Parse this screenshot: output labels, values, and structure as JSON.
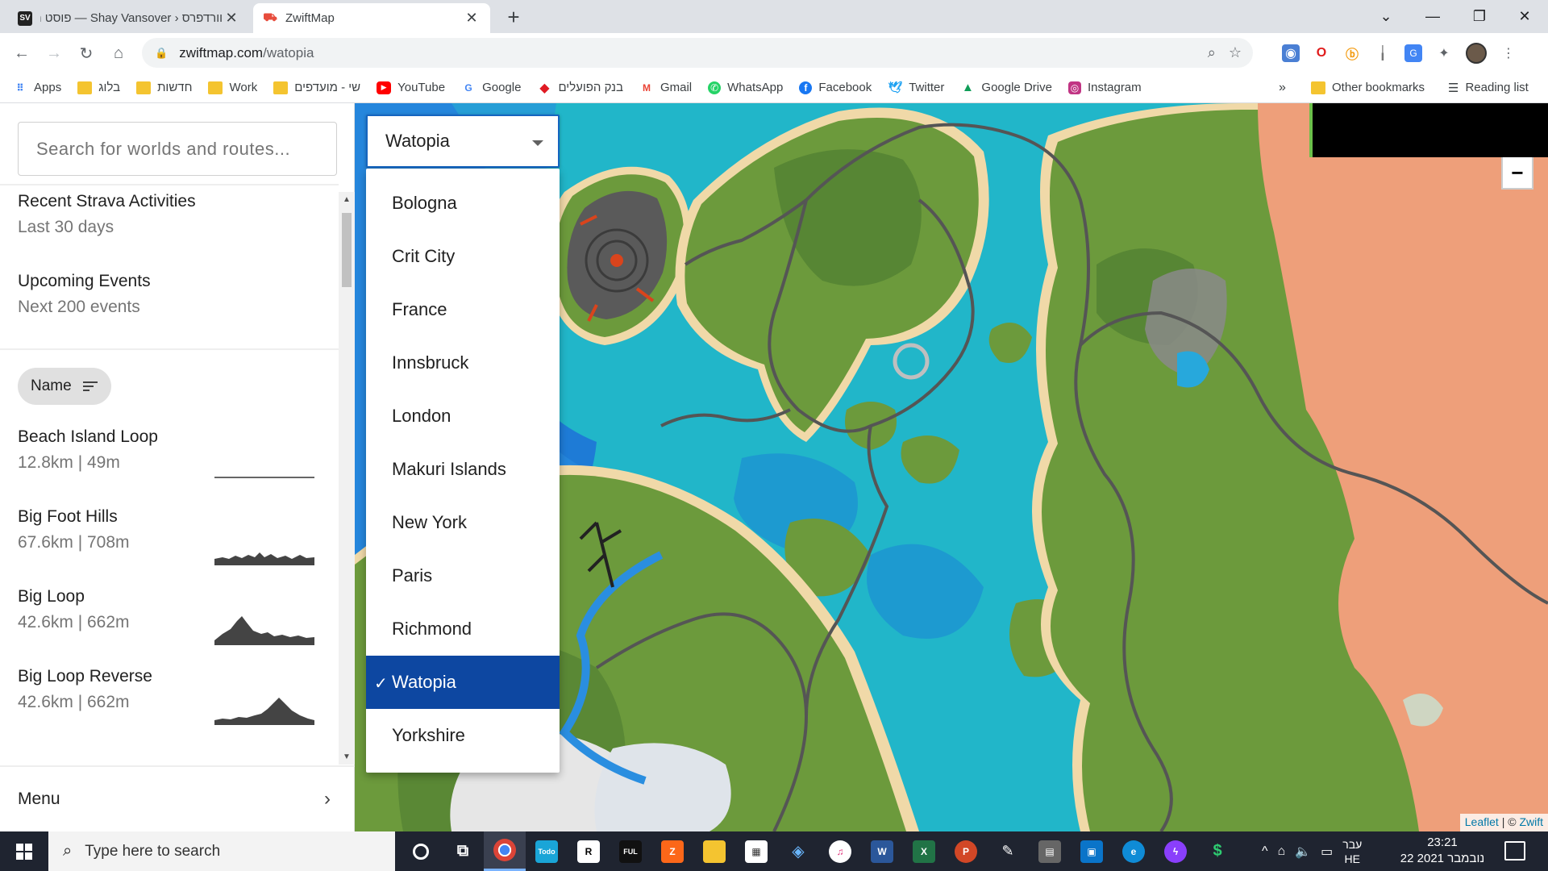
{
  "browser": {
    "tabs": [
      {
        "title": "וורדפרס ‹ Shay Vansover — פוסט חדש",
        "favicon": "SV"
      },
      {
        "title": "ZwiftMap",
        "favicon": "zwift-icon"
      }
    ],
    "url_host": "zwiftmap.com",
    "url_path": "/watopia",
    "bookmarks": [
      {
        "label": "Apps",
        "icon": "apps-grid-icon"
      },
      {
        "label": "בלוג",
        "icon": "folder-icon"
      },
      {
        "label": "חדשות",
        "icon": "folder-icon"
      },
      {
        "label": "Work",
        "icon": "folder-icon"
      },
      {
        "label": "שי - מועדפים",
        "icon": "folder-icon"
      },
      {
        "label": "YouTube",
        "icon": "youtube-icon"
      },
      {
        "label": "Google",
        "icon": "google-icon"
      },
      {
        "label": "בנק הפועלים",
        "icon": "bank-icon"
      },
      {
        "label": "Gmail",
        "icon": "gmail-icon"
      },
      {
        "label": "WhatsApp",
        "icon": "whatsapp-icon"
      },
      {
        "label": "Facebook",
        "icon": "facebook-icon"
      },
      {
        "label": "Twitter",
        "icon": "twitter-icon"
      },
      {
        "label": "Google Drive",
        "icon": "drive-icon"
      },
      {
        "label": "Instagram",
        "icon": "instagram-icon"
      }
    ],
    "bookmarks_more": "»",
    "other_bookmarks": "Other bookmarks",
    "reading_list": "Reading list"
  },
  "sidebar": {
    "search_placeholder": "Search for worlds and routes...",
    "sections": [
      {
        "title": "Recent Strava Activities",
        "subtitle": "Last 30 days"
      },
      {
        "title": "Upcoming Events",
        "subtitle": "Next 200 events"
      }
    ],
    "sort_chip": "Name",
    "routes": [
      {
        "name": "Beach Island Loop",
        "stats": "12.8km | 49m"
      },
      {
        "name": "Big Foot Hills",
        "stats": "67.6km | 708m"
      },
      {
        "name": "Big Loop",
        "stats": "42.6km | 662m"
      },
      {
        "name": "Big Loop Reverse",
        "stats": "42.6km | 662m"
      }
    ],
    "menu_label": "Menu"
  },
  "map": {
    "selected_world": "Watopia",
    "worlds": [
      "Bologna",
      "Crit City",
      "France",
      "Innsbruck",
      "London",
      "Makuri Islands",
      "New York",
      "Paris",
      "Richmond",
      "Watopia",
      "Yorkshire"
    ],
    "selected_index": 9,
    "check_mark": "✓",
    "zoom_out": "−",
    "attribution_leaflet": "Leaflet",
    "attribution_sep": " | © ",
    "attribution_zwift": "Zwift",
    "colors": {
      "water": "#21b6c9",
      "deep_water": "#1e7bd6",
      "land": "#6c9a3c",
      "desert": "#ee9f7a",
      "selected": "#0d47a1"
    }
  },
  "taskbar": {
    "search_placeholder": "Type here to search",
    "lang_top": "עבר",
    "lang_bottom": "HE",
    "time": "23:21",
    "date": "22 נובמבר 2021"
  }
}
